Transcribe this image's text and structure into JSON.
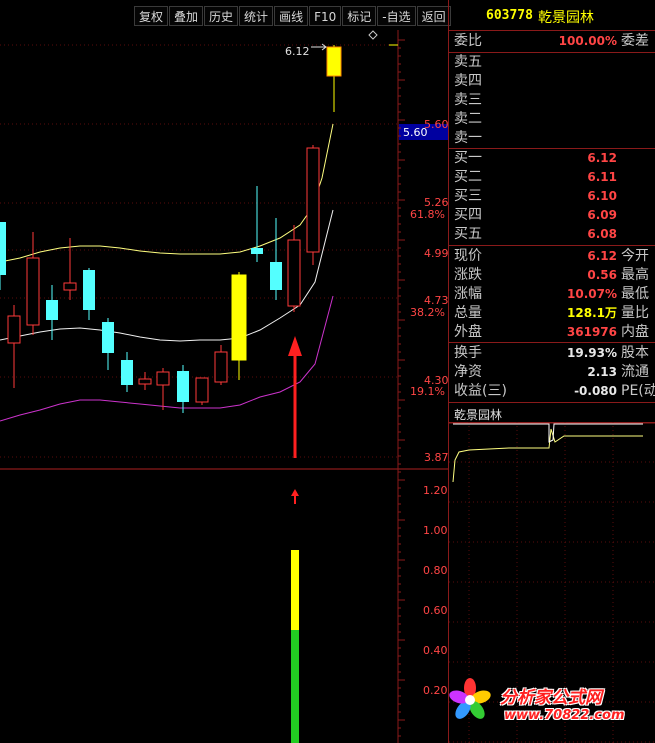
{
  "toolbar": {
    "buttons": [
      "复权",
      "叠加",
      "历史",
      "统计",
      "画线",
      "F10",
      "标记",
      "-自选",
      "返回"
    ]
  },
  "stock": {
    "code": "603778",
    "name": "乾景园林"
  },
  "chart": {
    "price_axis_labels": [
      "5.60",
      "5.26",
      "61.8%",
      "4.99",
      "4.73",
      "38.2%",
      "4.30",
      "19.1%",
      "3.87"
    ],
    "current_price_tag": "5.60",
    "high_label": "6.12",
    "indicator_axis_labels": [
      "1.20",
      "1.00",
      "0.80",
      "0.60",
      "0.40",
      "0.20"
    ],
    "indicator_bar_value": 0.9,
    "colors": {
      "up_candle": "#ff3a3a",
      "down_candle": "#54ffff",
      "limit_up_candle": "#ffff00",
      "band_upper": "#ffff80",
      "band_mid": "#f0f0f0",
      "band_lower": "#cc33cc",
      "arrow": "#ff2020",
      "indicator_yellow": "#ffff00",
      "indicator_green": "#22cc22"
    }
  },
  "order_book": {
    "commission_ratio_label": "委比",
    "commission_ratio_value": "100.00%",
    "commission_ratio_tail": "委差",
    "sell": [
      "卖五",
      "卖四",
      "卖三",
      "卖二",
      "卖一"
    ],
    "buy": [
      {
        "label": "买一",
        "price": "6.12"
      },
      {
        "label": "买二",
        "price": "6.11"
      },
      {
        "label": "买三",
        "price": "6.10"
      },
      {
        "label": "买四",
        "price": "6.09"
      },
      {
        "label": "买五",
        "price": "6.08"
      }
    ]
  },
  "quote": [
    {
      "label": "现价",
      "value": "6.12",
      "tail": "今开"
    },
    {
      "label": "涨跌",
      "value": "0.56",
      "tail": "最高"
    },
    {
      "label": "涨幅",
      "value": "10.07%",
      "tail": "最低"
    },
    {
      "label": "总量",
      "value": "128.1万",
      "tail": "量比"
    },
    {
      "label": "外盘",
      "value": "361976",
      "tail": "内盘"
    }
  ],
  "finance": [
    {
      "label": "换手",
      "value": "19.93%",
      "tail": "股本"
    },
    {
      "label": "净资",
      "value": "2.13",
      "tail": "流通"
    },
    {
      "label": "收益(三)",
      "value": "-0.080",
      "tail": "PE(动)"
    }
  ],
  "mini_chart_title": "乾景园林",
  "watermark": {
    "title": "分析家公式网",
    "url": "www.70822.com"
  }
}
